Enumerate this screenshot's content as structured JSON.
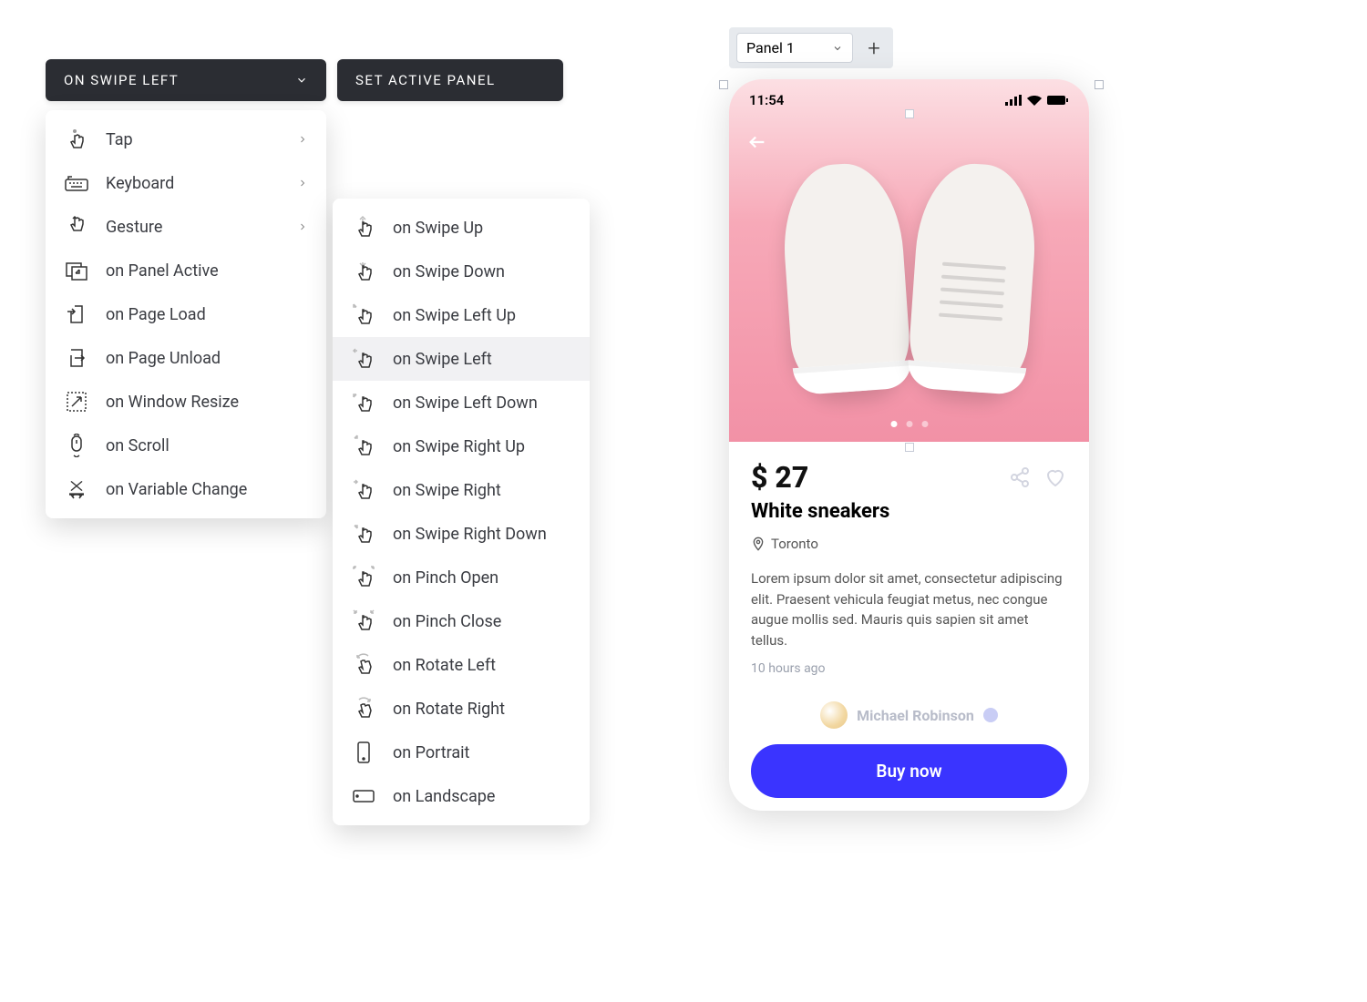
{
  "trigger_button": {
    "label": "ON SWIPE LEFT"
  },
  "action_button": {
    "label": "SET ACTIVE PANEL"
  },
  "trigger_menu": [
    {
      "label": "Tap",
      "has_sub": true
    },
    {
      "label": "Keyboard",
      "has_sub": true
    },
    {
      "label": "Gesture",
      "has_sub": true
    },
    {
      "label": "on Panel Active",
      "has_sub": false
    },
    {
      "label": "on Page Load",
      "has_sub": false
    },
    {
      "label": "on Page Unload",
      "has_sub": false
    },
    {
      "label": "on Window Resize",
      "has_sub": false
    },
    {
      "label": "on Scroll",
      "has_sub": false
    },
    {
      "label": "on Variable Change",
      "has_sub": false
    }
  ],
  "gesture_menu": [
    "on Swipe Up",
    "on Swipe Down",
    "on Swipe Left Up",
    "on Swipe Left",
    "on Swipe Left Down",
    "on Swipe Right Up",
    "on Swipe Right",
    "on Swipe Right Down",
    "on Pinch Open",
    "on Pinch Close",
    "on Rotate Left",
    "on Rotate Right",
    "on Portrait",
    "on Landscape"
  ],
  "gesture_selected_index": 3,
  "panel_selector": {
    "value": "Panel 1"
  },
  "phone": {
    "time": "11:54",
    "price": "$ 27",
    "title": "White sneakers",
    "location": "Toronto",
    "description": "Lorem ipsum dolor sit amet, consectetur adipiscing elit. Praesent vehicula feugiat metus, nec congue augue mollis sed. Mauris quis sapien sit amet tellus.",
    "posted": "10 hours ago",
    "seller": "Michael Robinson",
    "cta": "Buy now",
    "dots": {
      "count": 3,
      "active": 0
    }
  }
}
